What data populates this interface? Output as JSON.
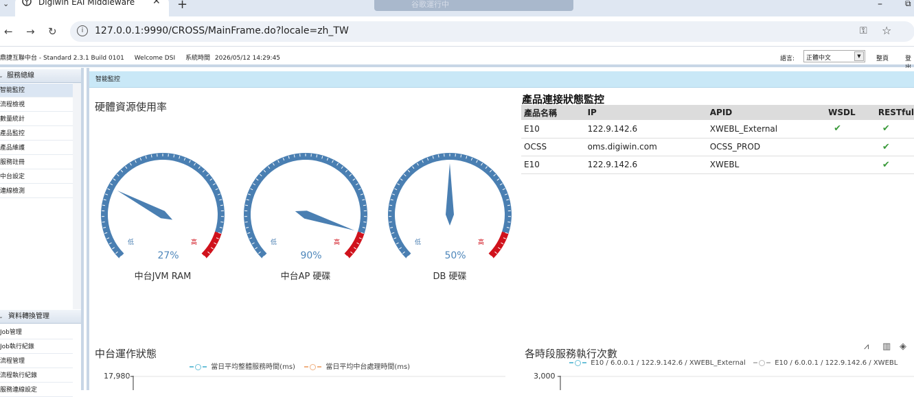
{
  "browser": {
    "tab_title": "Digiwin EAI Middleware",
    "center_text": "谷歌運行中",
    "url": "127.0.0.1:9990/CROSS/MainFrame.do?locale=zh_TW"
  },
  "header": {
    "product": "鼎捷互聯中台 - Standard 2.3.1 Build 0101",
    "welcome": "Welcome DSI",
    "system_time_label": "系統時間",
    "system_time": "2026/05/12 14:29:45",
    "lang_label": "語言:",
    "lang_value": "正體中文",
    "home_link": "整頁",
    "logout_link": "登出"
  },
  "sidebar": {
    "group1": "服務總線",
    "items1": [
      "智能監控",
      "流程檢視",
      "數量統計",
      "產品監控",
      "產品維護",
      "服務註冊",
      "中台設定",
      "連線檢測"
    ],
    "group2": "資料轉換管理",
    "items2": [
      "Job管理",
      "Job執行紀錄",
      "流程管理",
      "流程執行紀錄",
      "服務連線設定"
    ]
  },
  "main": {
    "breadcrumb": "智能監控",
    "hw_title": "硬體資源使用率",
    "gauges": [
      {
        "name": "中台JVM RAM",
        "value_label": "27%",
        "value": 27,
        "low": "低",
        "high": "高"
      },
      {
        "name": "中台AP 硬碟",
        "value_label": "90%",
        "value": 90,
        "low": "低",
        "high": "高"
      },
      {
        "name": "DB 硬碟",
        "value_label": "50%",
        "value": 50,
        "low": "低",
        "high": "高"
      }
    ],
    "conn_title": "產品連接狀態監控",
    "table": {
      "headers": [
        "產品名稱",
        "IP",
        "APID",
        "WSDL",
        "RESTful"
      ],
      "rows": [
        [
          "E10",
          "122.9.142.6",
          "XWEBL_External",
          "✔",
          "✔"
        ],
        [
          "OCSS",
          "oms.digiwin.com",
          "OCSS_PROD",
          "",
          "✔"
        ],
        [
          "E10",
          "122.9.142.6",
          "XWEBL",
          "",
          "✔"
        ]
      ]
    },
    "ops_title": "中台運作狀態",
    "ops_legend": [
      "當日平均整體服務時間(ms)",
      "當日平均中台處理時間(ms)"
    ],
    "ops_ytop": "17,980",
    "svc_title": "各時段服務執行次數",
    "svc_legend": [
      "E10 / 6.0.0.1 / 122.9.142.6 / XWEBL_External",
      "E10 / 6.0.0.1 / 122.9.142.6 / XWEBL"
    ],
    "svc_ytop": "3,000"
  },
  "colors": {
    "gauge_blue": "#4a7fb2",
    "gauge_red": "#d0121c",
    "crumb_bg": "#c9e8f7",
    "check_green": "#3a9a3a"
  }
}
